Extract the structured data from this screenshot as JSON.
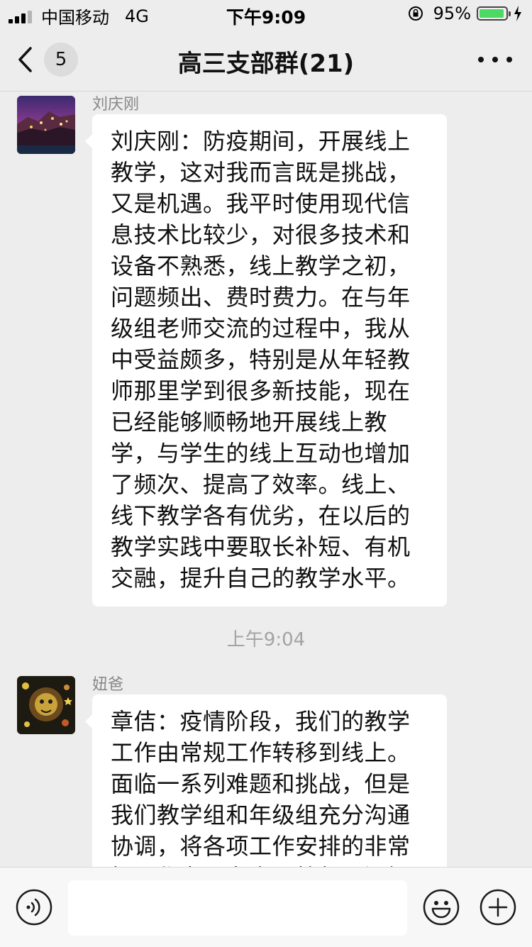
{
  "status_bar": {
    "carrier": "中国移动",
    "network": "4G",
    "time": "下午9:09",
    "battery_percent": "95%",
    "battery_level": 0.95
  },
  "nav": {
    "unread_count": "5",
    "title": "高三支部群(21)"
  },
  "messages": [
    {
      "sender": "刘庆刚",
      "text": "刘庆刚：防疫期间，开展线上教学，这对我而言既是挑战，又是机遇。我平时使用现代信息技术比较少，对很多技术和设备不熟悉，线上教学之初，问题频出、费时费力。在与年级组老师交流的过程中，我从中受益颇多，特别是从年轻教师那里学到很多新技能，现在已经能够顺畅地开展线上教学，与学生的线上互动也增加了频次、提高了效率。线上、线下教学各有优劣，在以后的教学实践中要取长补短、有机交融，提升自己的教学水平。"
    },
    {
      "sender": "妞爸",
      "text": "章佶：疫情阶段，我们的教学工作由常规工作转移到线上。面临一系列难题和挑战，但是我们教学组和年级组充分沟通协调，将各项工作安排的非常好。作为一名高三教师，深知"
    }
  ],
  "timestamp": "上午9:04",
  "icons": {
    "back": "chevron-left-icon",
    "more": "more-dots-icon",
    "voice": "voice-icon",
    "emoji": "emoji-icon",
    "plus": "plus-icon"
  },
  "colors": {
    "background": "#ededed",
    "bubble": "#ffffff",
    "battery": "#4cd964"
  }
}
